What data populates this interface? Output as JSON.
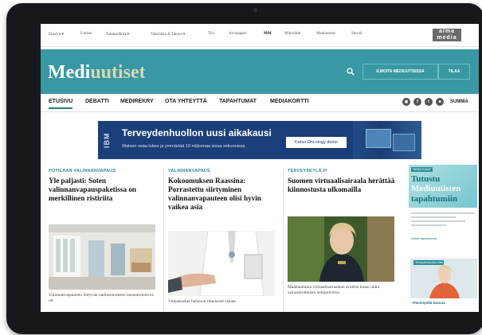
{
  "topnav": {
    "items": [
      "Etusivu ▾",
      "Uutiset",
      "Talouselämä ▾",
      "Tekniikka & Talous ▾",
      "Tivi",
      "Arvopaperi",
      "MM",
      "Mikrobitti",
      "Mediuutiset",
      "Skrolli"
    ],
    "active_index": 6,
    "brand_line1": "alma",
    "brand_line2": "media"
  },
  "header": {
    "logo_part1": "Medi",
    "logo_part2": "uutiset",
    "advertise_button": "ILMOITA MEDIUUTISISSA",
    "subscribe_button": "TILAA"
  },
  "mainnav": {
    "tabs": [
      "ETUSIVU",
      "DEBATTI",
      "MEDIREKRY",
      "OTA YHTEYTTÄ",
      "TAPAHTUMAT",
      "MEDIAKORTTI"
    ],
    "active_index": 0,
    "summa_label": "SUMMA"
  },
  "ad": {
    "brand": "IBM",
    "title": "Terveydenhuollon uusi aikakausi",
    "subtitle": "Watson osaa lukea ja ymmärtää 10 miljoonaa sivua sekunnissa",
    "cta": "Katso Oncology demo"
  },
  "articles": [
    {
      "category": "POTILAAN VALINNANVAPAUS",
      "headline": "Yle paljasti: Soten valinnanvapauspaketissa on merkillinen ristiriita",
      "excerpt": "Valinnanvapauteen liittyvän lakiluonnoksen lausuntokierros oli"
    },
    {
      "category": "VALINNANVAPAUS",
      "headline": "Kokoomuksen Raassina: Porrastettu siirtyminen valinnanvapauteen olisi hyvin vaikea asia",
      "excerpt": "Viekamiehet halusvat ilmeisesti rakata"
    },
    {
      "category": "TERVEYSKYLÄ.FI",
      "headline": "Suomen virtuaalisairaala herättää kiinnostusta ulkomailla",
      "excerpt": "Maamantaina virtuaalisairaalaan avattiin kuusi uutta sairauskohtaista nettipalvelua"
    }
  ],
  "sidebar": {
    "tag": "TAPAHTUMAT",
    "title_line1": "Tutustu",
    "title_line2": "Mediuutisten",
    "title_line3": "tapahtumiin",
    "link": "Kaikki tapahtumat",
    "photo_tag": "Terveydenhuollon Hitti",
    "caption": "Yhteistyöllä kasvua"
  },
  "colors": {
    "header_teal": "#3898a3",
    "logo_accent": "#d8d7b4",
    "category_teal": "#2a8a94",
    "ad_blue": "#1a3f7a"
  }
}
